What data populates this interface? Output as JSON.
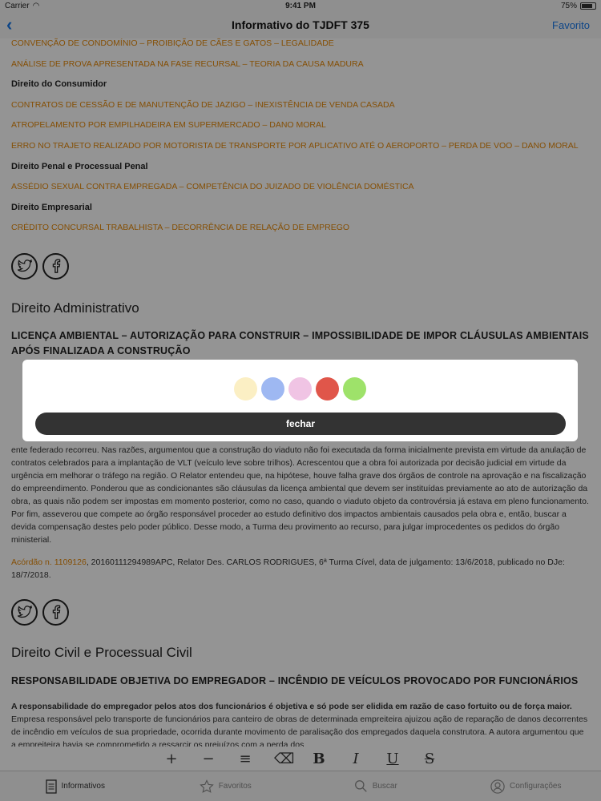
{
  "status_bar": {
    "carrier": "Carrier",
    "time": "9:41 PM",
    "battery": "75%"
  },
  "nav": {
    "back": "‹",
    "title": "Informativo do TJDFT 375",
    "favorite": "Favorito"
  },
  "links_top": [
    "CONVENÇÃO DE CONDOMÍNIO – PROIBIÇÃO DE CÃES E GATOS – LEGALIDADE",
    "ANÁLISE DE PROVA APRESENTADA NA FASE RECURSAL – TEORIA DA CAUSA MADURA"
  ],
  "categories": [
    {
      "title": "Direito do Consumidor",
      "links": [
        "CONTRATOS DE CESSÃO E DE MANUTENÇÃO DE JAZIGO – INEXISTÊNCIA DE VENDA CASADA",
        "ATROPELAMENTO POR EMPILHADEIRA EM SUPERMERCADO – DANO MORAL",
        "ERRO NO TRAJETO REALIZADO POR MOTORISTA DE TRANSPORTE POR APLICATIVO ATÉ O AEROPORTO – PERDA DE VOO – DANO MORAL"
      ]
    },
    {
      "title": "Direito Penal e Processual Penal",
      "links": [
        "ASSÉDIO SEXUAL CONTRA EMPREGADA – COMPETÊNCIA DO JUIZADO DE VIOLÊNCIA DOMÉSTICA"
      ]
    },
    {
      "title": "Direito Empresarial",
      "links": [
        "CRÉDITO CONCURSAL TRABALHISTA – DECORRÊNCIA DE RELAÇÃO DE EMPREGO"
      ]
    }
  ],
  "section1": {
    "title": "Direito Administrativo",
    "subtitle": "LICENÇA AMBIENTAL – AUTORIZAÇÃO PARA CONSTRUIR – IMPOSSIBILIDADE DE IMPOR CLÁUSULAS AMBIENTAIS APÓS FINALIZADA A CONSTRUÇÃO",
    "body": "ente federado recorreu. Nas razões, argumentou que a construção do viaduto não foi executada da forma inicialmente prevista em virtude da anulação de contratos celebrados para a implantação de VLT (veículo leve sobre trilhos). Acrescentou que a obra foi autorizada por decisão judicial em virtude da urgência em melhorar o tráfego na região. O Relator entendeu que, na hipótese, houve falha grave dos órgãos de controle na aprovação e na fiscalização do empreendimento. Ponderou que as condicionantes são cláusulas da licença ambiental que devem ser instituídas previamente ao ato de autorização da obra, as quais não podem ser impostas em momento posterior, como no caso, quando o viaduto objeto da controvérsia já estava em pleno funcionamento. Por fim, asseverou que compete ao órgão responsável proceder ao estudo definitivo dos impactos ambientais causados pela obra e, então, buscar a devida compensação destes pelo poder público. Desse modo, a Turma deu provimento ao recurso, para julgar improcedentes os pedidos do órgão ministerial.",
    "ref_link": "Acórdão n. 1109126",
    "ref_text": ", 20160111294989APC, Relator Des. CARLOS RODRIGUES, 6ª Turma Cível, data de julgamento: 13/6/2018, publicado no DJe: 18/7/2018."
  },
  "section2": {
    "title": "Direito Civil e Processual Civil",
    "subtitle": "RESPONSABILIDADE OBJETIVA DO EMPREGADOR – INCÊNDIO DE VEÍCULOS PROVOCADO POR FUNCIONÁRIOS",
    "bold": "A responsabilidade do empregador pelos atos dos funcionários é objetiva e só pode ser elidida em razão de caso fortuito ou de força maior.",
    "body": " Empresa responsável pelo transporte de funcionários para canteiro de obras de determinada empreiteira ajuizou ação de reparação de danos decorrentes de incêndio em veículos de sua propriedade, ocorrida durante movimento de paralisação dos empregados daquela construtora. A autora argumentou que a empreiteira havia se comprometido a ressarcir os prejuízos com a perda dos"
  },
  "format_bar": {
    "plus": "+",
    "minus": "−",
    "strike_center": "≡",
    "eraser": "⌫",
    "bold": "B",
    "italic": "I",
    "underline": "U",
    "strike": "S"
  },
  "tabs": [
    {
      "label": "Informativos",
      "icon": "document-icon",
      "active": true
    },
    {
      "label": "Favoritos",
      "icon": "star-icon",
      "active": false
    },
    {
      "label": "Buscar",
      "icon": "search-icon",
      "active": false
    },
    {
      "label": "Configurações",
      "icon": "user-icon",
      "active": false
    }
  ],
  "modal": {
    "colors": [
      "#fbefc4",
      "#9eb8f2",
      "#f0c4e4",
      "#e0564a",
      "#9ee26a"
    ],
    "close_label": "fechar"
  }
}
